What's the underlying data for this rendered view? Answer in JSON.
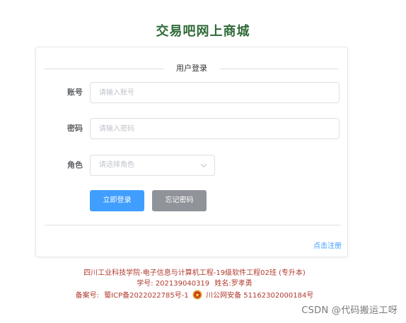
{
  "site": {
    "title": "交易吧网上商城"
  },
  "login": {
    "heading": "用户登录",
    "account": {
      "label": "账号",
      "placeholder": "请输入账号"
    },
    "password": {
      "label": "密码",
      "placeholder": "请输入密码"
    },
    "role": {
      "label": "角色",
      "placeholder": "请选择角色"
    },
    "login_button": "立即登录",
    "forgot_button": "忘记密码",
    "register_link": "点击注册"
  },
  "footer": {
    "line1": "四川工业科技学院-电子信息与计算机工程-19级软件工程02班 (专升本)",
    "student_id_label": "学号:",
    "student_id": "202139040319",
    "name_label": "姓名:",
    "name": "罗孝勇",
    "filing_label": "备案号:",
    "icp": "蜀ICP备2022022785号-1",
    "police": "川公网安备 51162302000184号"
  },
  "watermark": "CSDN @代码搬运工呀",
  "colors": {
    "title_green": "#2f6b39",
    "primary": "#409eff",
    "secondary": "#909399",
    "footer_red": "#b03a2e"
  }
}
